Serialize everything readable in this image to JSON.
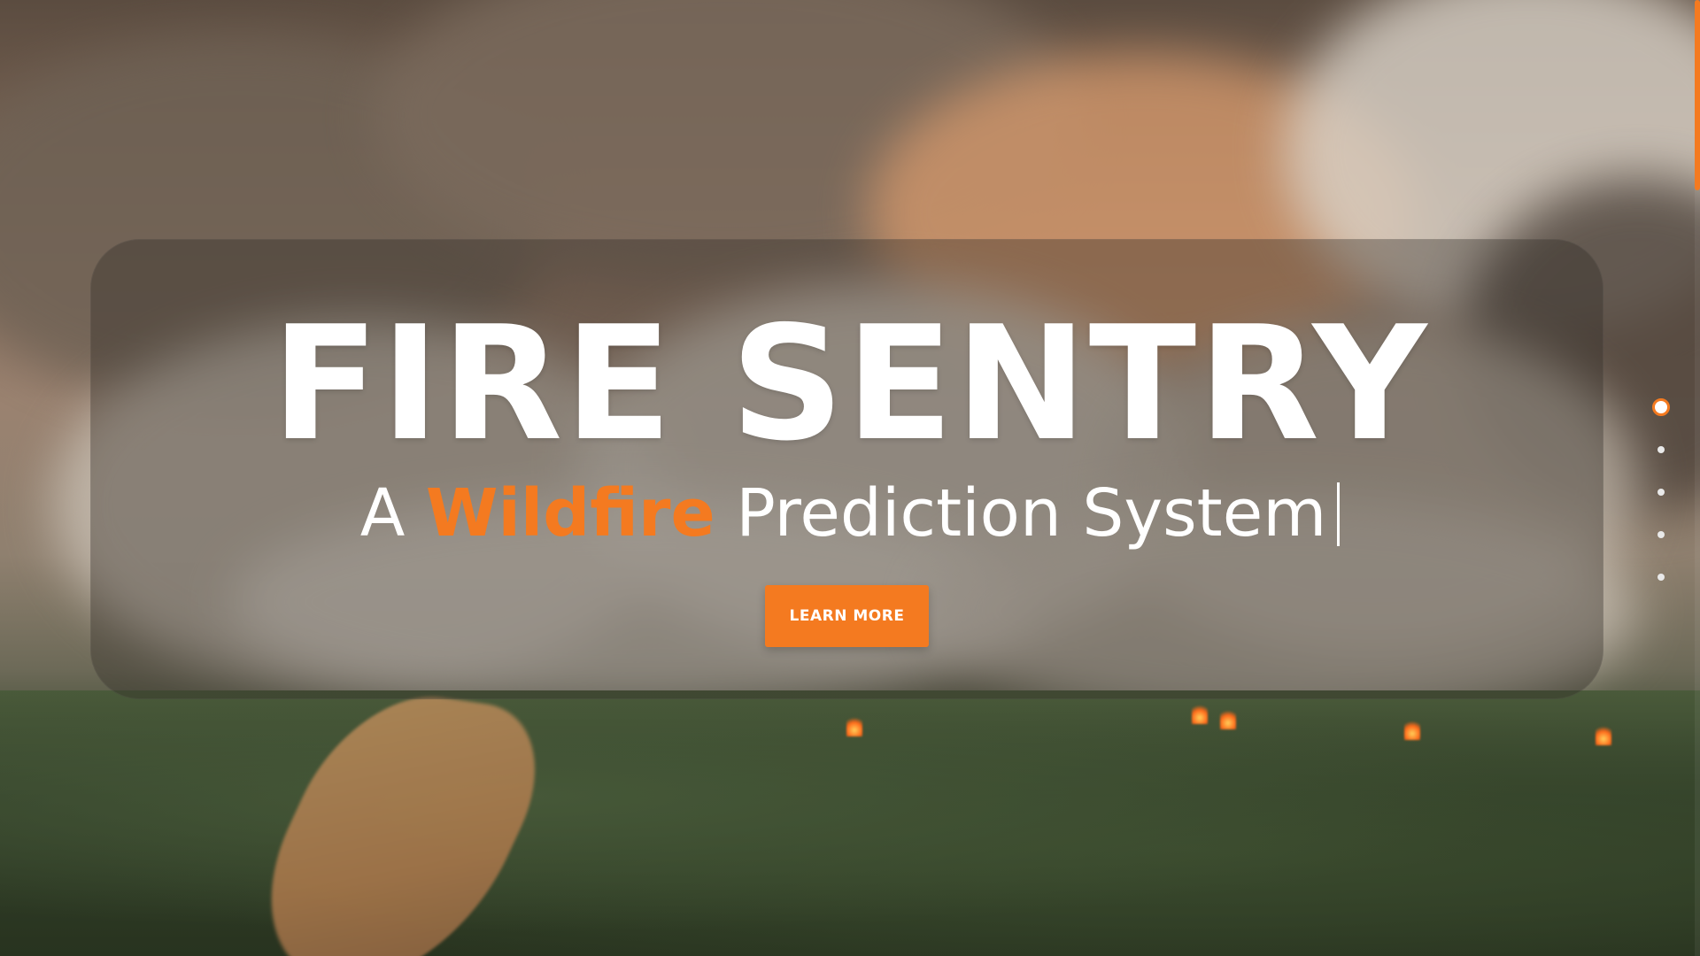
{
  "hero": {
    "title": "FIRE SENTRY",
    "subtitle_prefix": "A ",
    "subtitle_accent": "Wildfire",
    "subtitle_suffix": " Prediction System"
  },
  "cta": {
    "label": "LEARN MORE"
  },
  "section_nav": {
    "active_index": 0,
    "count": 5
  },
  "colors": {
    "accent": "#f47a20",
    "text": "#ffffff",
    "panel_overlay": "rgba(50,45,40,0.38)"
  },
  "icons": {
    "background": "wildfire-smoke-forest-image",
    "cursor": "typing-cursor"
  }
}
